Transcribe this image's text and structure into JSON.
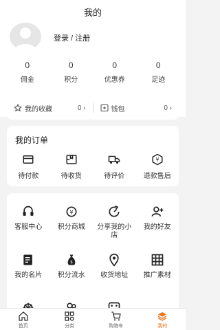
{
  "header": {
    "title": "我的"
  },
  "user": {
    "login_label": "登录 / 注册"
  },
  "stats": [
    {
      "value": "0",
      "label": "佣金"
    },
    {
      "value": "0",
      "label": "积分"
    },
    {
      "value": "0",
      "label": "优惠券"
    },
    {
      "value": "0",
      "label": "足迹"
    }
  ],
  "favorites": {
    "label": "我的收藏",
    "count": "0"
  },
  "wallet": {
    "label": "钱包",
    "count": "0"
  },
  "orders": {
    "title": "我的订单",
    "items": [
      {
        "label": "待付款",
        "icon": "card-icon"
      },
      {
        "label": "待收货",
        "icon": "package-icon"
      },
      {
        "label": "待评价",
        "icon": "truck-icon"
      },
      {
        "label": "退款售后",
        "icon": "refund-icon"
      }
    ]
  },
  "services": [
    {
      "label": "客服中心",
      "icon": "service-icon"
    },
    {
      "label": "积分商城",
      "icon": "points-mall-icon"
    },
    {
      "label": "分享我的小店",
      "icon": "share-icon"
    },
    {
      "label": "我的好友",
      "icon": "add-friend-icon"
    },
    {
      "label": "我的名片",
      "icon": "business-card-icon"
    },
    {
      "label": "积分流水",
      "icon": "money-bag-icon"
    },
    {
      "label": "收货地址",
      "icon": "location-icon"
    },
    {
      "label": "推广素材",
      "icon": "grid-icon"
    },
    {
      "label": "",
      "icon": "settings-icon"
    },
    {
      "label": "",
      "icon": "team-icon"
    },
    {
      "label": "",
      "icon": "dice-icon"
    }
  ],
  "tabbar": [
    {
      "label": "首页",
      "icon": "home-icon"
    },
    {
      "label": "分类",
      "icon": "category-icon"
    },
    {
      "label": "购物车",
      "icon": "cart-icon"
    },
    {
      "label": "我的",
      "icon": "profile-icon",
      "active": true
    }
  ],
  "colors": {
    "accent": "#e8731a",
    "background": "#f3f3f3"
  }
}
